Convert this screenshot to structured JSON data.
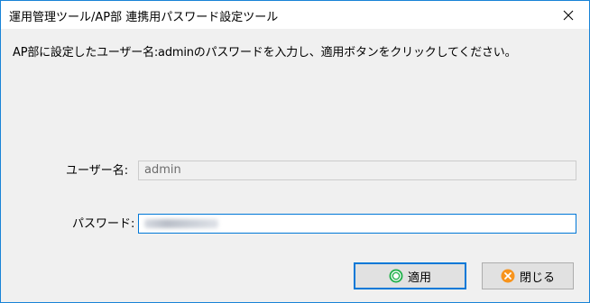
{
  "window": {
    "title": "運用管理ツール/AP部 連携用パスワード設定ツール",
    "close_icon": "close-icon"
  },
  "instruction": "AP部に設定したユーザー名:adminのパスワードを入力し、適用ボタンをクリックしてください。",
  "form": {
    "username_label": "ユーザー名:",
    "username_value": "admin",
    "password_label": "パスワード:",
    "password_value_obscured": true
  },
  "buttons": {
    "apply_label": "適用",
    "apply_icon": "green-check-circle-icon",
    "close_label": "閉じる",
    "close_icon": "orange-x-circle-icon"
  },
  "colors": {
    "window_border": "#1883d7",
    "focus_border": "#0078d7",
    "dialog_bg": "#f0f0f0",
    "apply_icon_green": "#22b14c",
    "close_icon_orange": "#f7941d"
  }
}
